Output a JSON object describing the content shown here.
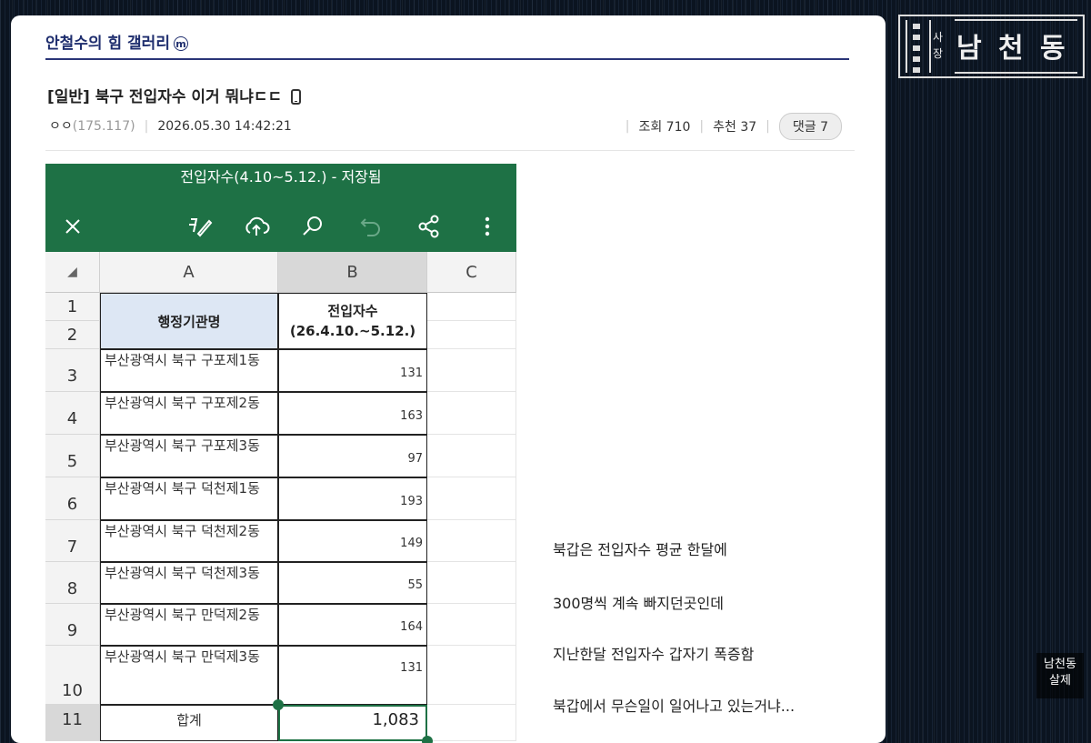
{
  "gallery": {
    "title": "안철수의 힘 갤러리",
    "badge": "m"
  },
  "post": {
    "title": "[일반] 북구 전입자수 이거 뭐냐ㄷㄷ",
    "author": "ㅇㅇ",
    "ip": "(175.117)",
    "datetime": "2026.05.30 14:42:21",
    "views_label": "조회 710",
    "recommend_label": "추천 37",
    "comment_label": "댓글 7"
  },
  "sheet": {
    "title": "전입자수(4.10~5.12.) - 저장됨",
    "toolbar_icons": [
      "close-icon",
      "edit-pen-icon",
      "cloud-upload-icon",
      "search-icon",
      "undo-icon",
      "share-icon",
      "more-vert-icon"
    ],
    "columns": [
      "A",
      "B",
      "C"
    ],
    "corner": "◢",
    "header_a": "행정기관명",
    "header_b_line1": "전입자수",
    "header_b_line2": "(26.4.10.~5.12.)",
    "row_numbers": [
      "1",
      "2",
      "3",
      "4",
      "5",
      "6",
      "7",
      "8",
      "9",
      "10",
      "11"
    ],
    "rows": [
      {
        "name": "부산광역시 북구 구포제1동",
        "value": "131"
      },
      {
        "name": "부산광역시 북구 구포제2동",
        "value": "163"
      },
      {
        "name": "부산광역시 북구 구포제3동",
        "value": "97"
      },
      {
        "name": "부산광역시 북구 덕천제1동",
        "value": "193"
      },
      {
        "name": "부산광역시 북구 덕천제2동",
        "value": "149"
      },
      {
        "name": "부산광역시 북구 덕천제3동",
        "value": "55"
      },
      {
        "name": "부산광역시 북구 만덕제2동",
        "value": "164"
      },
      {
        "name": "부산광역시 북구 만덕제3동",
        "value": "131"
      }
    ],
    "total_label": "합계",
    "total_value": "1,083"
  },
  "body_lines": [
    "북갑은 전입자수 평균 한달에",
    "300명씩 계속 빠지던곳인데",
    "지난한달 전입자수 갑자기 폭증함",
    "북갑에서 무슨일이 일어나고 있는거냐..."
  ],
  "logo": {
    "small1": "사",
    "small2": "장",
    "big1": "남",
    "big2": "천",
    "big3": "동"
  },
  "watermark": {
    "line1": "남천동",
    "line2": "살제"
  }
}
